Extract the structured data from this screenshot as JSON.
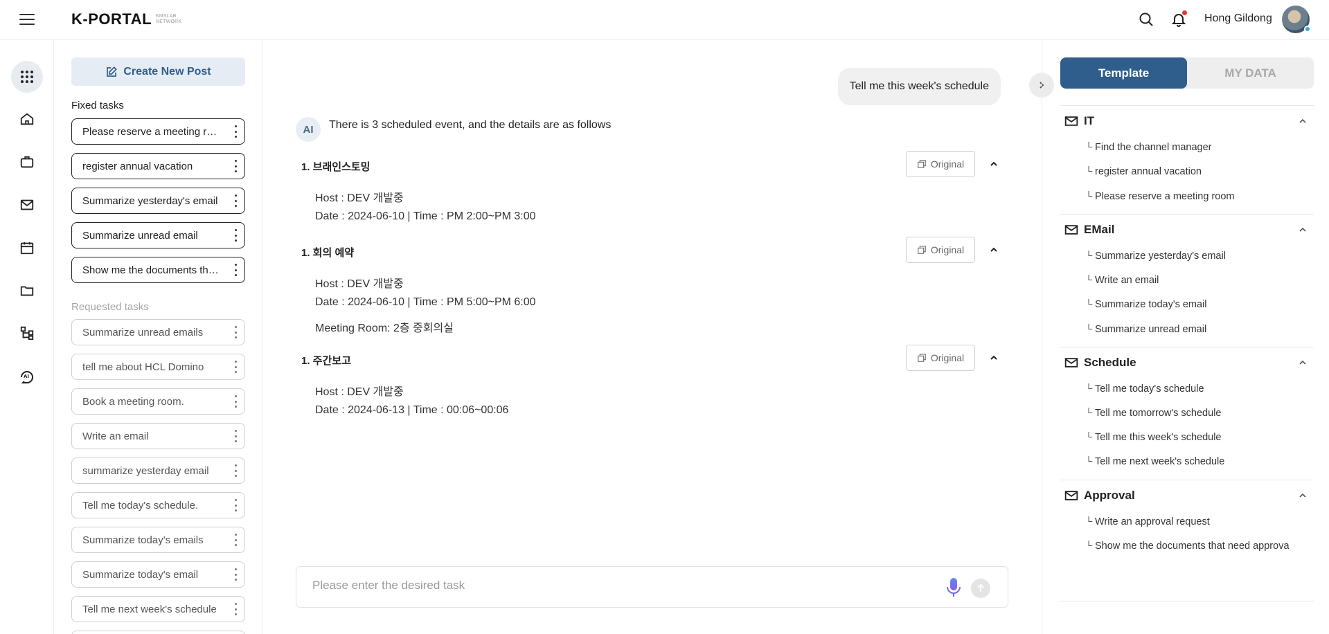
{
  "header": {
    "logo": "K-PORTAL",
    "logo_sub_1": "KMSLAB",
    "logo_sub_2": "NETWORK",
    "user_name": "Hong Gildong"
  },
  "left_panel": {
    "create_label": "Create New Post",
    "fixed_label": "Fixed tasks",
    "fixed_tasks": [
      "Please reserve a meeting room",
      "register annual vacation",
      "Summarize yesterday's email",
      "Summarize unread email",
      "Show me the documents that need approval"
    ],
    "requested_label": "Requested tasks",
    "requested_tasks": [
      "Summarize unread emails",
      "tell me about HCL Domino",
      "Book a meeting room.",
      "Write an email",
      "summarize yesterday email",
      "Tell me today's schedule.",
      "Summarize today's emails",
      "Summarize today's email",
      "Tell me next week's schedule"
    ]
  },
  "chat": {
    "user_message": "Tell me this week's schedule",
    "ai_badge": "AI",
    "ai_intro": "There is 3 scheduled event, and the details are as follows",
    "original_label": "Original",
    "events": [
      {
        "title": "1. 브래인스토밍",
        "lines": [
          "Host : DEV 개발중",
          "Date : 2024-06-10 | Time : PM 2:00~PM 3:00"
        ]
      },
      {
        "title": "1. 회의 예약",
        "lines": [
          "Host : DEV 개발중",
          "Date : 2024-06-10 | Time : PM 5:00~PM 6:00",
          "Meeting Room: 2층 중회의실"
        ]
      },
      {
        "title": "1. 주간보고",
        "lines": [
          "Host : DEV 개발중",
          "Date : 2024-06-13 | Time : 00:06~00:06"
        ]
      }
    ],
    "input_placeholder": "Please enter the desired task"
  },
  "right_panel": {
    "tab_template": "Template",
    "tab_mydata": "MY DATA",
    "categories": [
      {
        "name": "IT",
        "items": [
          "Find the channel manager",
          "register annual vacation",
          "Please reserve a meeting room"
        ]
      },
      {
        "name": "EMail",
        "items": [
          "Summarize yesterday's email",
          "Write an email",
          "Summarize today's email",
          "Summarize unread email"
        ]
      },
      {
        "name": "Schedule",
        "items": [
          "Tell me today's schedule",
          "Tell me tomorrow's schedule",
          "Tell me this week's schedule",
          "Tell me next week's schedule"
        ]
      },
      {
        "name": "Approval",
        "items": [
          "Write an approval request",
          "Show me the documents that need approval"
        ]
      }
    ]
  },
  "colors": {
    "accent": "#2f5d8c",
    "notification": "#e53935"
  }
}
